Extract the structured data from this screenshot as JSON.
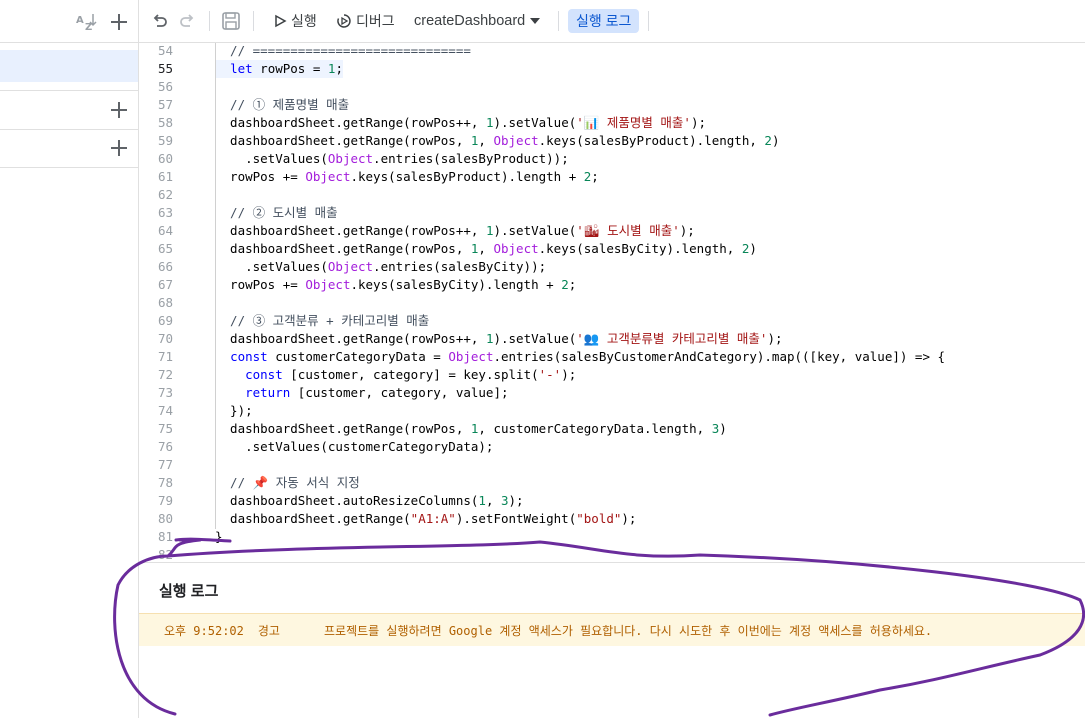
{
  "toolbar": {
    "run_label": "실행",
    "debug_label": "디버그",
    "function_name": "createDashboard",
    "run_log_label": "실행 로그"
  },
  "editor": {
    "lines": [
      {
        "n": "54",
        "code": "  // ============================="
      },
      {
        "n": "55",
        "code": "  let rowPos = 1;"
      },
      {
        "n": "56",
        "code": ""
      },
      {
        "n": "57",
        "code": "  // ① 제품명별 매출"
      },
      {
        "n": "58",
        "code": "  dashboardSheet.getRange(rowPos++, 1).setValue('📊 제품명별 매출');"
      },
      {
        "n": "59",
        "code": "  dashboardSheet.getRange(rowPos, 1, Object.keys(salesByProduct).length, 2)"
      },
      {
        "n": "60",
        "code": "    .setValues(Object.entries(salesByProduct));"
      },
      {
        "n": "61",
        "code": "  rowPos += Object.keys(salesByProduct).length + 2;"
      },
      {
        "n": "62",
        "code": ""
      },
      {
        "n": "63",
        "code": "  // ② 도시별 매출"
      },
      {
        "n": "64",
        "code": "  dashboardSheet.getRange(rowPos++, 1).setValue('🏙 도시별 매출');"
      },
      {
        "n": "65",
        "code": "  dashboardSheet.getRange(rowPos, 1, Object.keys(salesByCity).length, 2)"
      },
      {
        "n": "66",
        "code": "    .setValues(Object.entries(salesByCity));"
      },
      {
        "n": "67",
        "code": "  rowPos += Object.keys(salesByCity).length + 2;"
      },
      {
        "n": "68",
        "code": ""
      },
      {
        "n": "69",
        "code": "  // ③ 고객분류 + 카테고리별 매출"
      },
      {
        "n": "70",
        "code": "  dashboardSheet.getRange(rowPos++, 1).setValue('👥 고객분류별 카테고리별 매출');"
      },
      {
        "n": "71",
        "code": "  const customerCategoryData = Object.entries(salesByCustomerAndCategory).map(([key, value]) => {"
      },
      {
        "n": "72",
        "code": "    const [customer, category] = key.split('-');"
      },
      {
        "n": "73",
        "code": "    return [customer, category, value];"
      },
      {
        "n": "74",
        "code": "  });"
      },
      {
        "n": "75",
        "code": "  dashboardSheet.getRange(rowPos, 1, customerCategoryData.length, 3)"
      },
      {
        "n": "76",
        "code": "    .setValues(customerCategoryData);"
      },
      {
        "n": "77",
        "code": ""
      },
      {
        "n": "78",
        "code": "  // 📌 자동 서식 지정"
      },
      {
        "n": "79",
        "code": "  dashboardSheet.autoResizeColumns(1, 3);"
      },
      {
        "n": "80",
        "code": "  dashboardSheet.getRange(\"A1:A\").setFontWeight(\"bold\");"
      },
      {
        "n": "81",
        "code": "}"
      },
      {
        "n": "82",
        "code": ""
      }
    ]
  },
  "log": {
    "title": "실행 로그",
    "entries": [
      {
        "time": "오후 9:52:02",
        "level": "경고",
        "message": "프로젝트를 실행하려면 Google 계정 액세스가 필요합니다. 다시 시도한 후 이번에는 계정 액세스를 허용하세요."
      }
    ]
  },
  "colors": {
    "accent": "#0b57d0",
    "log_warning_bg": "#fef7e0",
    "log_warning_text": "#b06000",
    "annotation": "#6a2c9c"
  }
}
